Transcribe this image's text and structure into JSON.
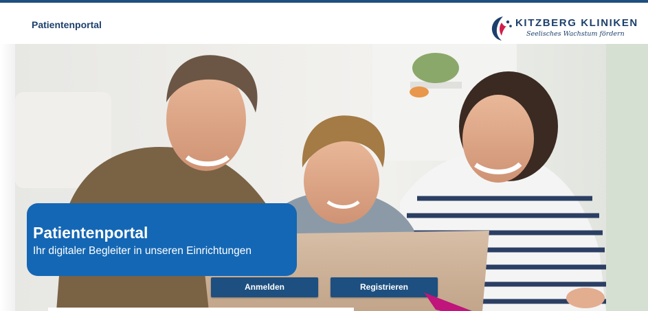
{
  "header": {
    "title": "Patientenportal",
    "logo": {
      "name": "KITZBERG KLINIKEN",
      "tagline": "Seelisches Wachstum fördern"
    }
  },
  "hero": {
    "image": "family-with-laptop-photo",
    "heading": "Patientenportal",
    "subheading": "Ihr digitaler Begleiter in unseren Einrichtungen"
  },
  "actions": {
    "login_label": "Anmelden",
    "register_label": "Registrieren"
  },
  "colors": {
    "brand_navy": "#1c3f6b",
    "banner_blue": "#1467b4",
    "button_blue": "#1d4f80",
    "cursor_magenta": "#c0157a"
  },
  "icons": {
    "logo": "kitzberg-logo-icon",
    "cursor": "mouse-cursor-icon"
  }
}
